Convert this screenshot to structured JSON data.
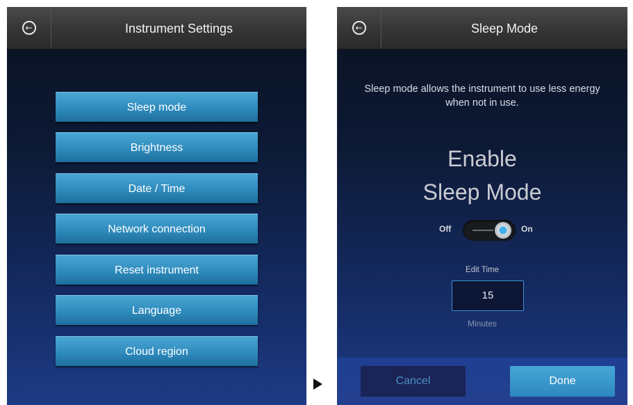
{
  "left_screen": {
    "title": "Instrument Settings",
    "menu": [
      {
        "label": "Sleep mode"
      },
      {
        "label": "Brightness"
      },
      {
        "label": "Date / Time"
      },
      {
        "label": "Network connection"
      },
      {
        "label": "Reset instrument"
      },
      {
        "label": "Language"
      },
      {
        "label": "Cloud region"
      }
    ]
  },
  "right_screen": {
    "title": "Sleep Mode",
    "description": "Sleep mode allows the instrument to use less energy when not in use.",
    "heading_line1": "Enable",
    "heading_line2": "Sleep Mode",
    "toggle": {
      "off_label": "Off",
      "on_label": "On",
      "state": "on"
    },
    "edit_time_label": "Edit Time",
    "time_value": "15",
    "minutes_label": "Minutes",
    "cancel_label": "Cancel",
    "done_label": "Done"
  },
  "icons": {
    "back": "back-arrow-circle-icon",
    "transition": "play-arrow-icon"
  },
  "colors": {
    "button_blue": "#2e8bbd",
    "toggle_accent": "#3fb0ee",
    "background_dark": "#0d1a35",
    "background_blue": "#1d3a85"
  }
}
